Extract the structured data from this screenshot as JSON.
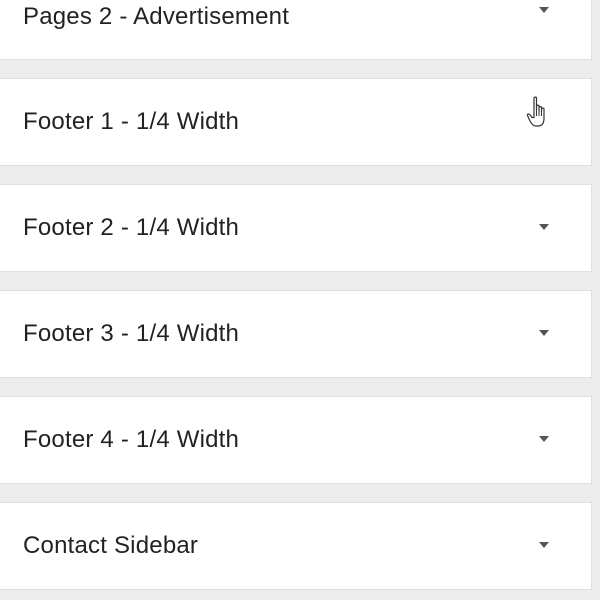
{
  "widget_areas": [
    {
      "title": "Pages 2 - Advertisement",
      "arrow_icon": "chevron-down-icon"
    },
    {
      "title": "Footer 1 - 1/4 Width",
      "arrow_icon": "none"
    },
    {
      "title": "Footer 2 - 1/4 Width",
      "arrow_icon": "chevron-down-icon"
    },
    {
      "title": "Footer 3 - 1/4 Width",
      "arrow_icon": "chevron-down-icon"
    },
    {
      "title": "Footer 4 - 1/4 Width",
      "arrow_icon": "chevron-down-icon"
    },
    {
      "title": "Contact Sidebar",
      "arrow_icon": "chevron-down-icon"
    }
  ],
  "cursor_icon": "hand-pointer-icon",
  "colors": {
    "background": "#ececec",
    "panel": "#ffffff",
    "panel_border": "#e0e0e0",
    "text": "#222222",
    "arrow": "#555555"
  }
}
